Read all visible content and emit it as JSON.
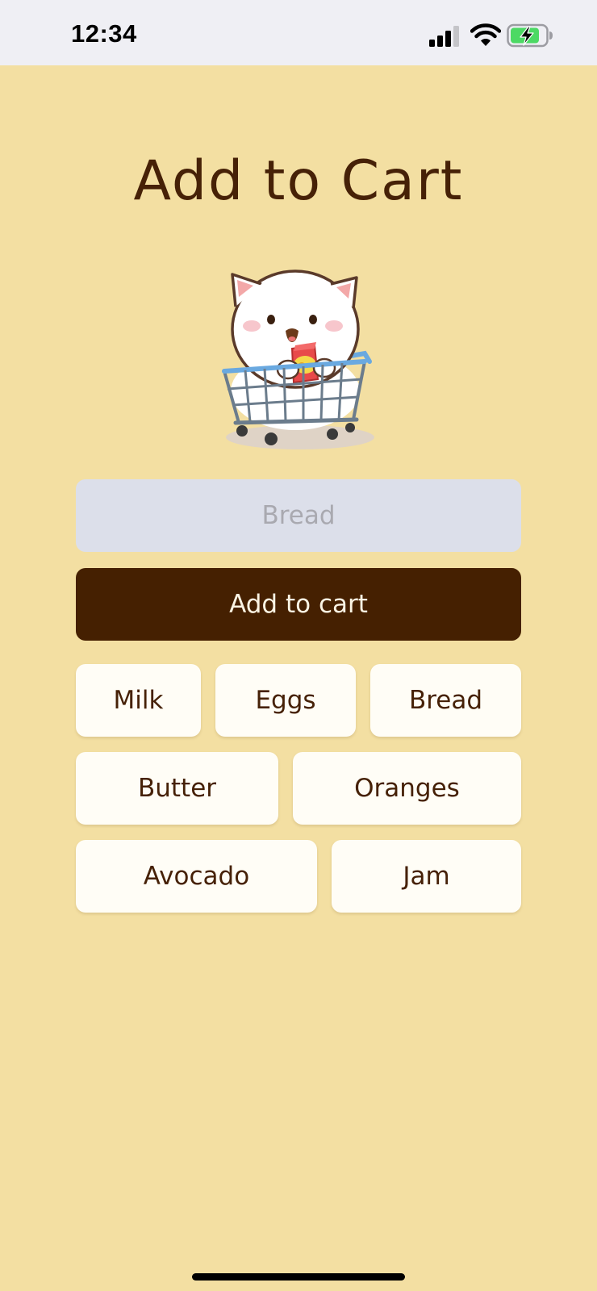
{
  "status_bar": {
    "time": "12:34"
  },
  "page": {
    "title": "Add to Cart"
  },
  "mascot": {
    "icon": "cat-in-shopping-cart-icon"
  },
  "item_input": {
    "placeholder": "Bread",
    "value": ""
  },
  "add_button": {
    "label": "Add to cart"
  },
  "suggestions": [
    {
      "label": "Milk"
    },
    {
      "label": "Eggs"
    },
    {
      "label": "Bread"
    },
    {
      "label": "Butter"
    },
    {
      "label": "Oranges"
    },
    {
      "label": "Avocado"
    },
    {
      "label": "Jam"
    }
  ],
  "colors": {
    "background": "#f3dfa2",
    "accent": "#452001",
    "input_background": "#dcdfea",
    "chip_background": "#fffdf6",
    "battery_charging": "#4cd964"
  }
}
